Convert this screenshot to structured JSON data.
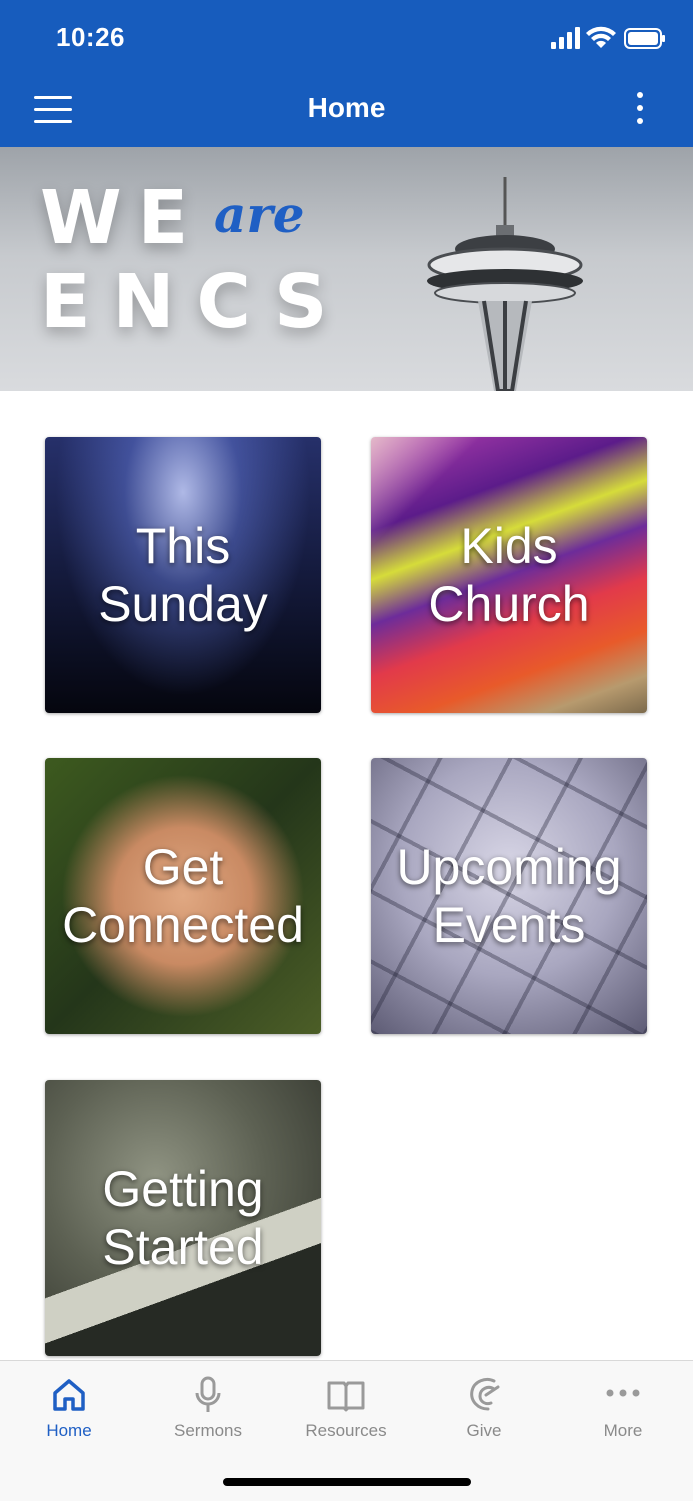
{
  "status_bar": {
    "time": "10:26"
  },
  "app_bar": {
    "title": "Home"
  },
  "banner": {
    "line1": "WE",
    "accent": "are",
    "line2": "ENCS"
  },
  "tiles": [
    {
      "label": "This\nSunday"
    },
    {
      "label": "Kids\nChurch"
    },
    {
      "label": "Get\nConnected"
    },
    {
      "label": "Upcoming\nEvents"
    },
    {
      "label": "Getting\nStarted"
    }
  ],
  "bottom_nav": {
    "items": [
      {
        "label": "Home",
        "icon": "home-icon",
        "active": true
      },
      {
        "label": "Sermons",
        "icon": "microphone-icon",
        "active": false
      },
      {
        "label": "Resources",
        "icon": "book-icon",
        "active": false
      },
      {
        "label": "Give",
        "icon": "give-icon",
        "active": false
      },
      {
        "label": "More",
        "icon": "more-dots-icon",
        "active": false
      }
    ]
  },
  "colors": {
    "brand": "#175cbd",
    "accent": "#1f5fc4",
    "inactive": "#8a8a8a"
  }
}
